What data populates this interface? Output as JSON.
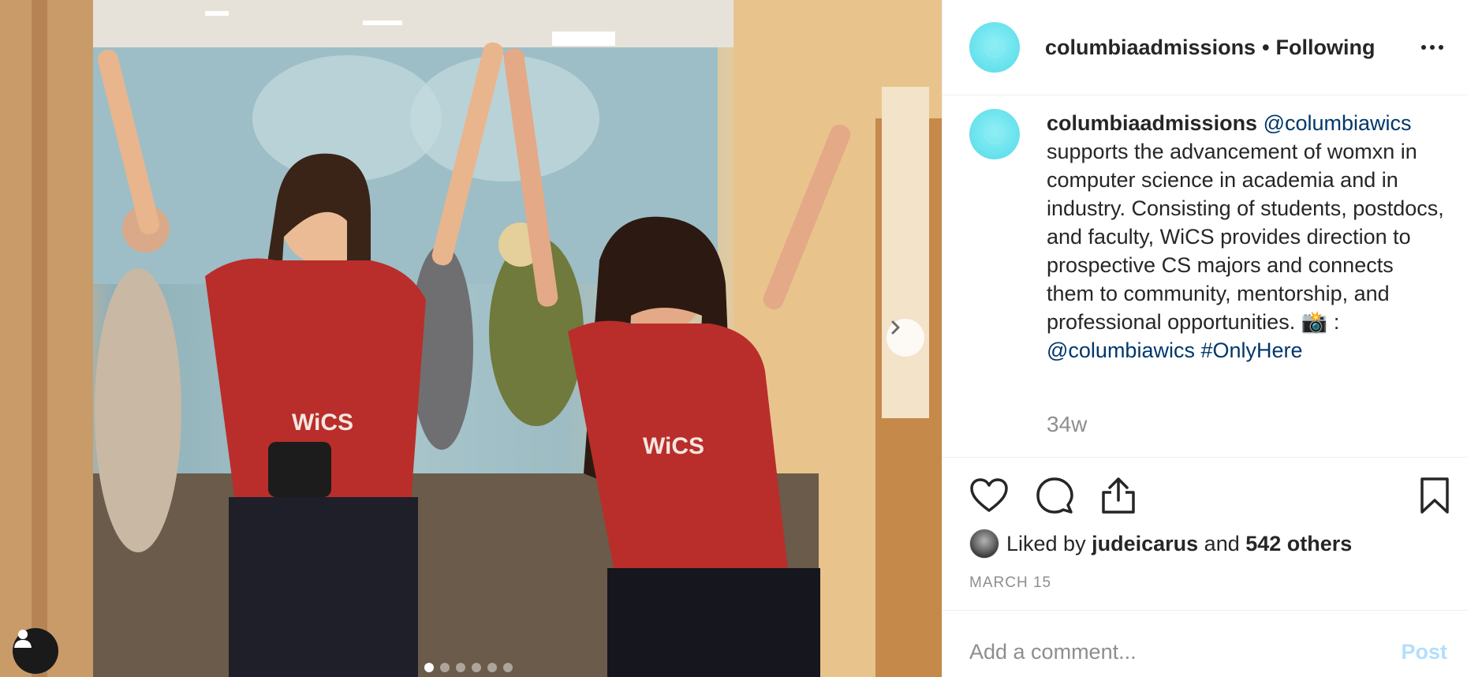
{
  "post": {
    "image": {
      "description_icon": "photo-two-women-cheering-wics",
      "next_icon": "chevron-right-icon",
      "user_tag_icon": "person-icon",
      "carousel": {
        "count": 6,
        "active_index": 0
      }
    },
    "header": {
      "username": "columbiaadmissions",
      "separator": "•",
      "follow_status": "Following",
      "more_icon": "more-horizontal-icon"
    },
    "caption": {
      "author": "columbiaadmissions",
      "mention_1": "@columbiawics",
      "body": "supports the advancement of womxn in computer science in academia and in industry. Consisting of students, postdocs, and faculty, WiCS provides direction to prospective CS majors and connects them to community, mentorship, and professional opportunities. 📸 : ",
      "mention_2": "@columbiawics",
      "hashtag": "#OnlyHere"
    },
    "time_ago": "34w",
    "actions": {
      "like_icon": "heart-icon",
      "comment_icon": "comment-icon",
      "share_icon": "share-icon",
      "save_icon": "bookmark-icon"
    },
    "likes": {
      "prefix": "Liked by",
      "user": "judeicarus",
      "conjunction": "and",
      "others": "542 others"
    },
    "date": "MARCH 15",
    "comment": {
      "placeholder": "Add a comment...",
      "post_label": "Post"
    },
    "colors": {
      "accent_link": "#00376b",
      "post_disabled": "#b2dffc",
      "muted": "#8e8e8e",
      "avatar_bg": "#6be3ee"
    }
  }
}
